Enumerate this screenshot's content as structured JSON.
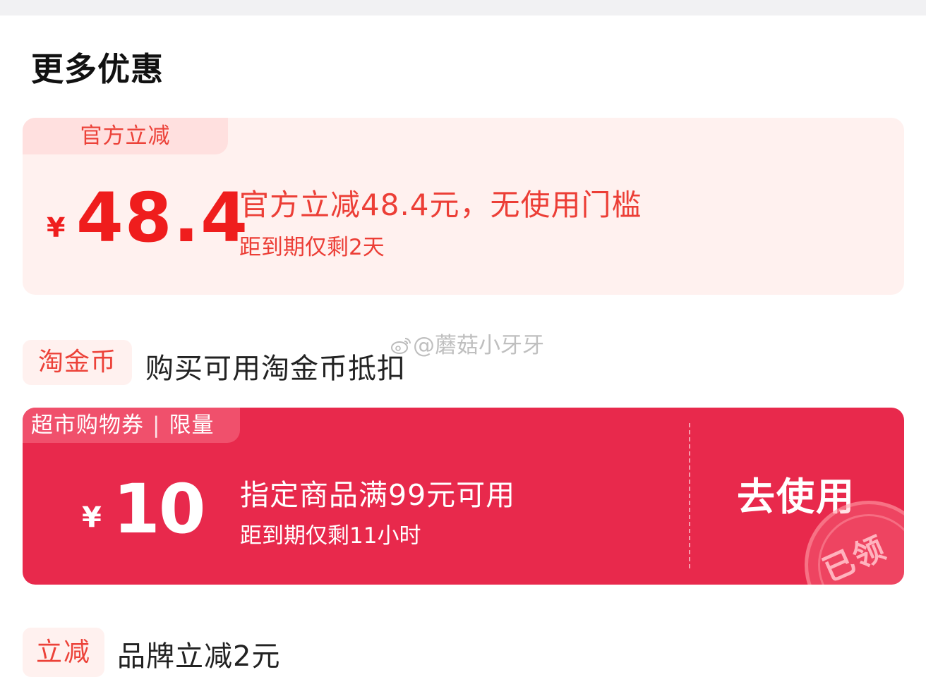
{
  "page": {
    "title": "更多优惠"
  },
  "official": {
    "tag": "官方立减",
    "currency": "¥",
    "amount": "48.4",
    "description": "官方立减48.4元，无使用门槛",
    "expiry": "距到期仅剩2天"
  },
  "taojinbi": {
    "badge": "淘金币",
    "text": "购买可用淘金币抵扣"
  },
  "watermark": {
    "text": "@蘑菇小牙牙",
    "icon": "weibo-icon"
  },
  "market_coupon": {
    "tag": "超市购物券",
    "tag_extra": "限量",
    "currency": "¥",
    "amount": "10",
    "description": "指定商品满99元可用",
    "expiry": "距到期仅剩11小时",
    "button": "去使用",
    "stamp": "已领"
  },
  "brand": {
    "badge": "立减",
    "text": "品牌立减2元"
  },
  "colors": {
    "accent_red": "#ef1d1d",
    "coupon_red": "#e8294c",
    "soft_pink": "#fff1ef"
  }
}
